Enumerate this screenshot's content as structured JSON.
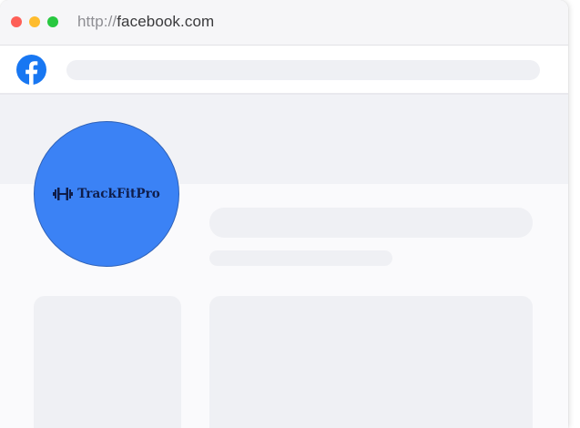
{
  "browser": {
    "url_scheme": "http://",
    "url_domain": "facebook.com",
    "traffic_lights": [
      "close",
      "minimize",
      "zoom"
    ]
  },
  "navbar": {
    "logo_icon": "facebook-logo-icon",
    "brand_color": "#1877f2"
  },
  "profile": {
    "avatar_color": "#3b82f5",
    "brand_name": "TrackFitPro",
    "brand_icon": "dumbbell-icon"
  }
}
